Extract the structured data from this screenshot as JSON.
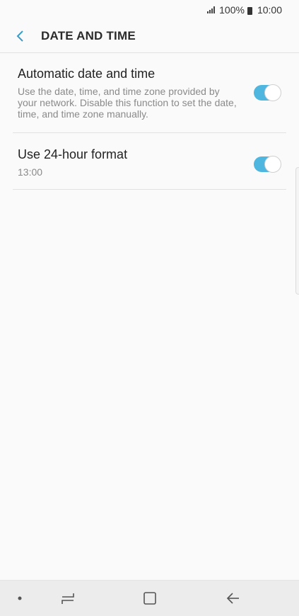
{
  "status_bar": {
    "battery": "100%",
    "time": "10:00"
  },
  "header": {
    "title": "DATE AND TIME",
    "back_icon": "chevron-left-icon"
  },
  "settings": {
    "auto": {
      "title": "Automatic date and time",
      "description": "Use the date, time, and time zone provided by your network. Disable this function to set the date, time, and time zone manually.",
      "enabled": true
    },
    "format24": {
      "title": "Use 24-hour format",
      "value": "13:00",
      "enabled": true
    }
  },
  "colors": {
    "accent": "#4fb6df",
    "back_icon": "#3a9dc7"
  },
  "nav_bar": {
    "icons": [
      "dot-icon",
      "recent-apps-icon",
      "home-icon",
      "back-arrow-icon"
    ]
  }
}
